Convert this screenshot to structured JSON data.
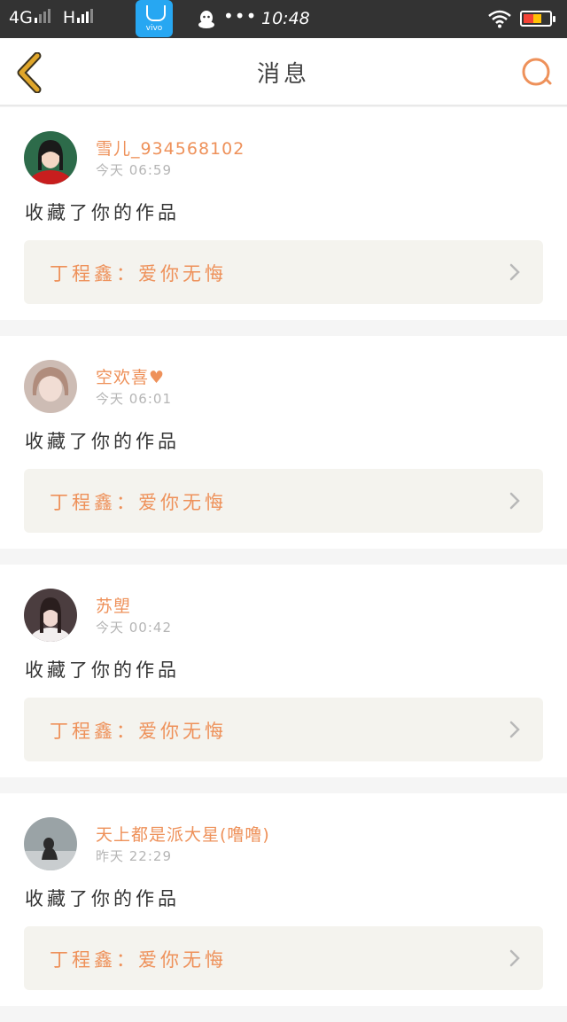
{
  "status_bar": {
    "network1": "4G",
    "network2": "H",
    "app_label": "vivo",
    "dots": "•••",
    "time": "10:48"
  },
  "header": {
    "title": "消息",
    "back_icon": "chevron-left-icon",
    "search_icon": "search-icon"
  },
  "colors": {
    "accent": "#ee915a",
    "back": "#e0a62a",
    "card_bg": "#ffffff",
    "work_bg": "#f4f3ee"
  },
  "messages": [
    {
      "username": "雪儿_934568102",
      "time": "今天 06:59",
      "action": "收藏了你的作品",
      "work": "丁程鑫：爱你无悔"
    },
    {
      "username": "空欢喜♥",
      "time": "今天 06:01",
      "action": "收藏了你的作品",
      "work": "丁程鑫：爱你无悔"
    },
    {
      "username": "苏塱",
      "time": "今天 00:42",
      "action": "收藏了你的作品",
      "work": "丁程鑫：爱你无悔"
    },
    {
      "username": "天上都是派大星(噜噜)",
      "time": "昨天 22:29",
      "action": "收藏了你的作品",
      "work": "丁程鑫：爱你无悔"
    }
  ]
}
